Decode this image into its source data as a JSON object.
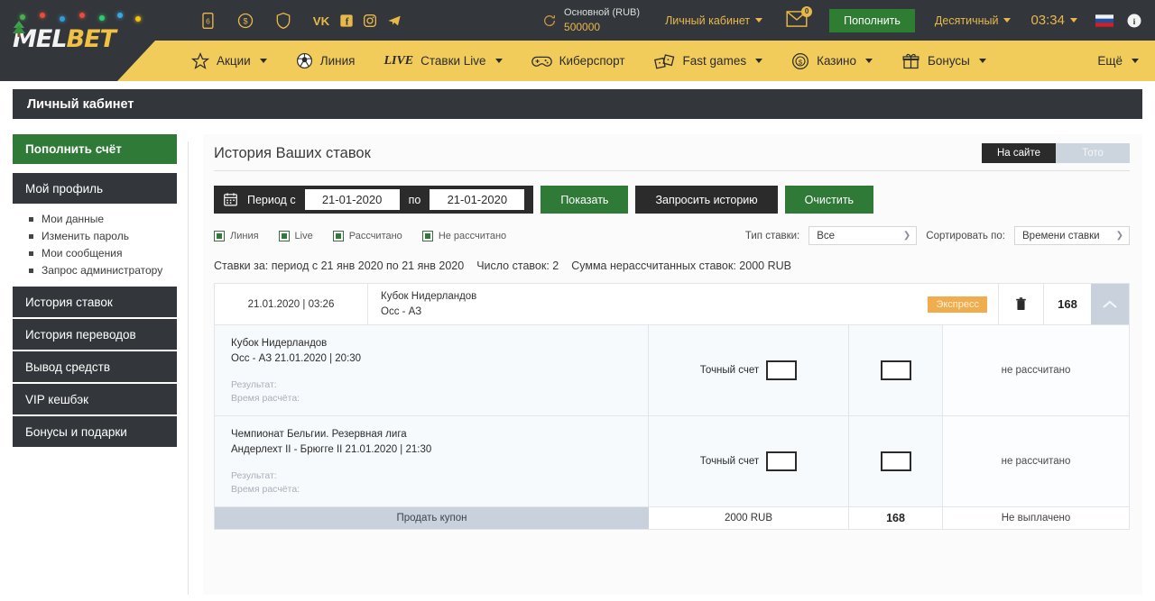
{
  "topbar": {
    "icons": [
      "mobile-app-icon",
      "dollar-coin-icon",
      "shield-icon"
    ],
    "social": [
      "vk-icon",
      "facebook-icon",
      "instagram-icon",
      "telegram-icon"
    ],
    "balance_label": "Основной (RUB)",
    "balance_amount": "500000",
    "account_link": "Личный кабинет",
    "mail_badge": "0",
    "deposit_button": "Пополнить",
    "odds_format": "Десятичный",
    "clock": "03:34",
    "flag": "ru-flag-icon",
    "info": "info-icon"
  },
  "logo": {
    "part1": "MEL",
    "part2": "BET"
  },
  "nav": {
    "items": [
      {
        "label": "Акции",
        "icon": "star-icon",
        "caret": true
      },
      {
        "label": "Линия",
        "icon": "football-icon",
        "caret": false
      },
      {
        "label": "Ставки Live",
        "icon": "live-tag",
        "tag": "LIVE",
        "caret": true
      },
      {
        "label": "Киберспорт",
        "icon": "gamepad-icon",
        "caret": false
      },
      {
        "label": "Fast games",
        "icon": "dice-icon",
        "caret": true
      },
      {
        "label": "Казино",
        "icon": "casino-chip-icon",
        "caret": true
      },
      {
        "label": "Бонусы",
        "icon": "gift-icon",
        "caret": true
      }
    ],
    "more": "Ещё"
  },
  "page_title": "Личный кабинет",
  "sidebar": {
    "deposit_button": "Пополнить счёт",
    "profile_header": "Мой профиль",
    "profile_items": [
      "Мои данные",
      "Изменить пароль",
      "Мои сообщения",
      "Запрос администратору"
    ],
    "menu": [
      "История ставок",
      "История переводов",
      "Вывод средств",
      "VIP кешбэк",
      "Бонусы и подарки"
    ]
  },
  "content": {
    "title": "История Ваших ставок",
    "tabs": [
      {
        "label": "На сайте",
        "active": true
      },
      {
        "label": "Тото",
        "active": false
      }
    ],
    "filter": {
      "calendar_icon": "calendar-icon",
      "period_from_label": "Период с",
      "date_from": "21-01-2020",
      "period_to_label": "по",
      "date_to": "21-01-2020",
      "show_button": "Показать",
      "request_button": "Запросить историю",
      "clear_button": "Очистить"
    },
    "checkboxes": [
      {
        "label": "Линия",
        "checked": true
      },
      {
        "label": "Live",
        "checked": true
      },
      {
        "label": "Рассчитано",
        "checked": true
      },
      {
        "label": "Не рассчитано",
        "checked": true
      }
    ],
    "selects": [
      {
        "label": "Тип ставки:",
        "value": "Все"
      },
      {
        "label": "Сортировать по:",
        "value": "Времени ставки"
      }
    ],
    "summary": [
      "Ставки за: период с 21 янв 2020 по 21 янв 2020",
      "Число ставок: 2",
      "Сумма нерассчитанных ставок: 2000 RUB"
    ],
    "coupon": {
      "date": "21.01.2020 | 03:26",
      "tournament": "Кубок Нидерландов",
      "match": "Осс - АЗ",
      "badge": "Экспресс",
      "delete_icon": "trash-icon",
      "amount": "168",
      "collapse_icon": "chevron-up-icon",
      "rows": [
        {
          "tournament": "Кубок Нидерландов",
          "match": "Осс - АЗ 21.01.2020 | 20:30",
          "result_label": "Результат:",
          "calc_time_label": "Время расчёта:",
          "market": "Точный счет",
          "market_value": "",
          "coef_value": "",
          "status": "не рассчитано"
        },
        {
          "tournament": "Чемпионат Бельгии. Резервная лига",
          "match": "Андерлехт II - Брюгге II 21.01.2020 | 21:30",
          "result_label": "Результат:",
          "calc_time_label": "Время расчёта:",
          "market": "Точный счет",
          "market_value": "",
          "coef_value": "",
          "status": "не рассчитано"
        }
      ],
      "footer": {
        "sell_label": "Продать купон",
        "sum": "2000 RUB",
        "coef": "168",
        "payout": "Не выплачено"
      }
    }
  },
  "colors": {
    "dark": "#33373b",
    "yellow": "#f2cc5b",
    "green": "#2f7a37",
    "orange": "#f0ad4e",
    "steel": "#c9d2dc"
  }
}
